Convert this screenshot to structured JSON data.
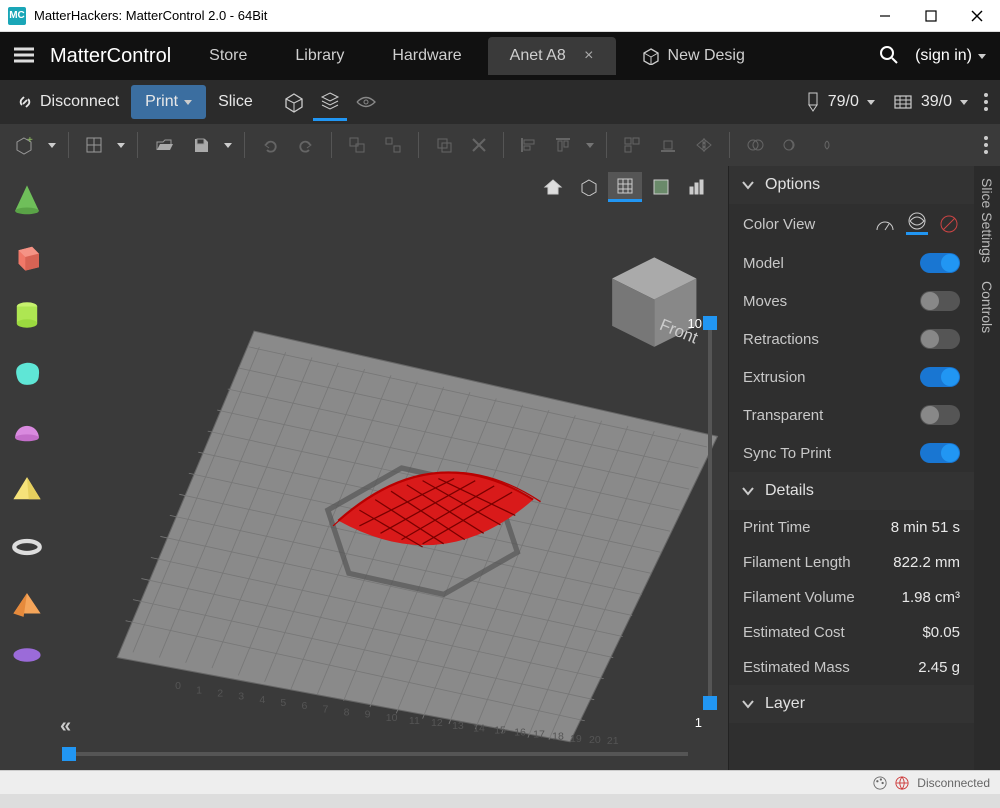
{
  "window": {
    "title": "MatterHackers: MatterControl 2.0 - 64Bit",
    "app_icon_text": "MC"
  },
  "top": {
    "brand": "MatterControl",
    "tabs": {
      "store": "Store",
      "library": "Library",
      "hardware": "Hardware",
      "active": "Anet A8",
      "new": "New Desig"
    },
    "signin": "(sign in)"
  },
  "actions": {
    "disconnect": "Disconnect",
    "print": "Print",
    "slice": "Slice",
    "hotend": "79/0",
    "bed": "39/0"
  },
  "options": {
    "title": "Options",
    "color_view": "Color View",
    "model": "Model",
    "moves": "Moves",
    "retractions": "Retractions",
    "extrusion": "Extrusion",
    "transparent": "Transparent",
    "sync": "Sync To Print"
  },
  "toggles": {
    "model": true,
    "moves": false,
    "retractions": false,
    "extrusion": true,
    "transparent": false,
    "sync": true
  },
  "details": {
    "title": "Details",
    "rows": {
      "print_time_k": "Print Time",
      "print_time_v": "8 min 51 s",
      "fil_len_k": "Filament Length",
      "fil_len_v": "822.2 mm",
      "fil_vol_k": "Filament Volume",
      "fil_vol_v": "1.98 cm³",
      "cost_k": "Estimated Cost",
      "cost_v": "$0.05",
      "mass_k": "Estimated Mass",
      "mass_v": "2.45 g"
    }
  },
  "layer_section": "Layer",
  "vertical_tabs": {
    "slice": "Slice Settings",
    "controls": "Controls"
  },
  "slider": {
    "top": "10",
    "bottom": "1"
  },
  "cube_label": "Front",
  "status": {
    "disconnected": "Disconnected"
  }
}
